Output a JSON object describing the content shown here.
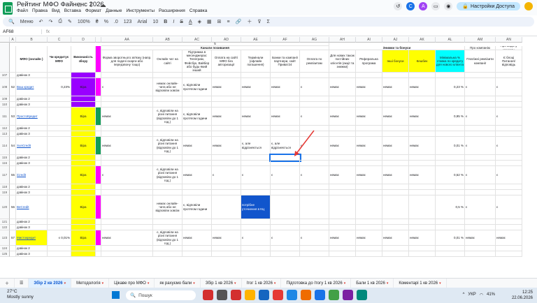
{
  "window": {
    "title": "Рейтинг МФО Файненс 2026"
  },
  "menu": [
    "Файл",
    "Правка",
    "Вид",
    "Вставка",
    "Формат",
    "Данные",
    "Инструменты",
    "Расширения",
    "Справка"
  ],
  "share_label": "Настройки Доступа",
  "avatars": [
    "C",
    "A"
  ],
  "toolbar": {
    "search": "Меню",
    "zoom": "100%",
    "currency": "₴",
    "percent": "%",
    "decimals": ".0",
    ".00": ".00",
    "format": "123",
    "font": "Arial",
    "size": "10"
  },
  "namebox": "AF68",
  "formula": "",
  "columns": [
    "A",
    "B",
    "C",
    "D",
    "AA",
    "AB",
    "AC",
    "AD",
    "AE",
    "AF",
    "AG",
    "AH",
    "AI",
    "AJ",
    "AK",
    "AL",
    "AM",
    "AN",
    "AO"
  ],
  "group_headers": {
    "channels": "Канали позивання",
    "discounts": "Знижки та бонуси",
    "num5": "5"
  },
  "headers": {
    "no": "№",
    "mfo": "МФО (онлайн )",
    "credit": "Чи кредитує МФО",
    "exec": "Виконаність збору",
    "AA": "Форма зворотнього зв'язку (напр. для подачі скарги або передзвону тощо)",
    "AB": "Онлайн чат на сайті",
    "AC": "Підтримка в месенджерах: Телеграм, Фейсбук, Вайбер або будь-який інший",
    "AD": "Оплата на сайті МФО без авторизації",
    "AE": "Термінали (офлайн погашення)",
    "AF": "Банки та компанії партнери, сайт Приват24",
    "AG": "Оплата по реквізитам",
    "AH": "Для нових також постійних клієнтів (акції та знижки)",
    "AI": "Реферальна програма",
    "AJ": "Інші бонуси",
    "AK": "Кешбек",
    "AL": "Мінімальна % ставка по кредиту для нового клієнта",
    "AM": "Про компанію",
    "AM2": "Платіжні реквізити компанії",
    "AN": "Про видачу кредиту",
    "AN2": "Є блоці Питання/відповідь"
  },
  "rows": [
    {
      "n": "107",
      "b": "дзвінок 3"
    },
    {
      "n": "108",
      "a": "52",
      "b": "Ваш кредит",
      "link": true,
      "c": "0,23%",
      "d": "Віра",
      "ab": "немає онлайн-чата або не відповіли зовсім",
      "ac": "є, відповіли протягом години",
      "ad": "немає",
      "ae": "немає",
      "af": "немає",
      "ag": "є",
      "ah": "немає",
      "ai": "немає",
      "aj": "немає",
      "ak": "немає",
      "al": "0,23 %",
      "am": "є",
      "an": "є",
      "aa": "є"
    },
    {
      "n": "109",
      "b": "дзвінок 2"
    },
    {
      "n": "110",
      "b": "дзвінок 3"
    },
    {
      "n": "111",
      "a": "53",
      "b": "ПростоКредит",
      "link": true,
      "d": "Віра",
      "aa": "немає",
      "ab": "є, відповіли на різні питання (відповіли до 1 год.)",
      "ac": "є, відповіли протягом години",
      "ad": "немає",
      "ae": "немає",
      "af": "немає",
      "ag": "є",
      "ah": "немає",
      "ai": "немає",
      "aj": "немає",
      "ak": "немає",
      "al": "0,95 %",
      "am": "є",
      "an": "є"
    },
    {
      "n": "112",
      "b": "дзвінок 2"
    },
    {
      "n": "113",
      "b": "дзвінок 3"
    },
    {
      "n": "114",
      "a": "54",
      "b": "SunCredit",
      "link": true,
      "d": "Віра",
      "aa": "немає",
      "ab": "є, відповіли на різні питання (відповіли до 1 год.)",
      "ac": "немає",
      "ad": "немає",
      "ae": "є, але відрізняється",
      "af": "є, але відрізняється",
      "ag": "є",
      "ah": "немає",
      "ai": "немає",
      "aj": "немає",
      "ak": "немає",
      "al": "0,01 %",
      "am": "є",
      "an": "є"
    },
    {
      "n": "115",
      "b": "дзвінок 2"
    },
    {
      "n": "116",
      "b": "дзвінок 3"
    },
    {
      "n": "117",
      "a": "55",
      "b": "iCredit",
      "link": true,
      "d": "Віра",
      "aa": "є",
      "ab": "є, відповіли на різні питання (відповіли до 1 год.)",
      "ac": "немає",
      "ad": "є",
      "ae": "є",
      "af": "є",
      "ag": "є",
      "ah": "немає",
      "ai": "немає",
      "aj": "немає",
      "ak": "немає",
      "al": "0,52 %",
      "am": "є",
      "an": "є"
    },
    {
      "n": "118",
      "b": "дзвінок 2"
    },
    {
      "n": "119",
      "b": "дзвінок 3"
    },
    {
      "n": "120",
      "a": "56",
      "b": "BeCredit",
      "link": true,
      "d": "Віра",
      "ab": "немає онлайн-чата або не відповіли зовсім",
      "ac": "є, відповіли протягом години",
      "ae": "потрібне уточнення в КЦ",
      "al": "0,5 %",
      "am": "є",
      "an": "є"
    },
    {
      "n": "121",
      "b": "дзвінок 2"
    },
    {
      "n": "122",
      "b": "дзвінок 3"
    },
    {
      "n": "123",
      "a": "57",
      "b": "Мистокредит",
      "link": true,
      "c": "є 0,01%",
      "d": "Віра",
      "aa": "немає",
      "ab": "є, відповіли на різні питання (відповіли до 1 год.)",
      "ac": "немає",
      "ad": "немає",
      "ae": "є",
      "af": "є",
      "ag": "є",
      "ah": "немає",
      "ai": "немає",
      "aj": "немає",
      "ak": "немає",
      "al": "0,01 %",
      "am": "немає",
      "an": "немає"
    },
    {
      "n": "124",
      "b": "дзвінок 2"
    },
    {
      "n": "125",
      "b": "дзвінок 3"
    }
  ],
  "tabs": [
    {
      "label": "Збір 2 кв 2026",
      "active": true
    },
    {
      "label": "Методологія"
    },
    {
      "label": "Цікаве про МФО"
    },
    {
      "label": "як рахуємо бали"
    },
    {
      "label": "Збір 1 кв 2026"
    },
    {
      "label": "Ітог 1 кв 2026"
    },
    {
      "label": "Підготовка до Ітогу 1 кв 2026"
    },
    {
      "label": "Бали 1 кв 2026"
    },
    {
      "label": "Коментарі 1 кв 2026"
    }
  ],
  "taskbar": {
    "temp": "27°C",
    "weather": "Mostly sunny",
    "search": "Пошук",
    "lang": "УКР",
    "battery": "41%",
    "time": "12:25",
    "date": "22.06.2026"
  },
  "colors": {
    "purple": "#9900ff",
    "yellow": "#ffff00",
    "magenta": "#ff00ff",
    "cyan": "#00ffff",
    "blue": "#1155cc",
    "green": "#0f9d58"
  }
}
